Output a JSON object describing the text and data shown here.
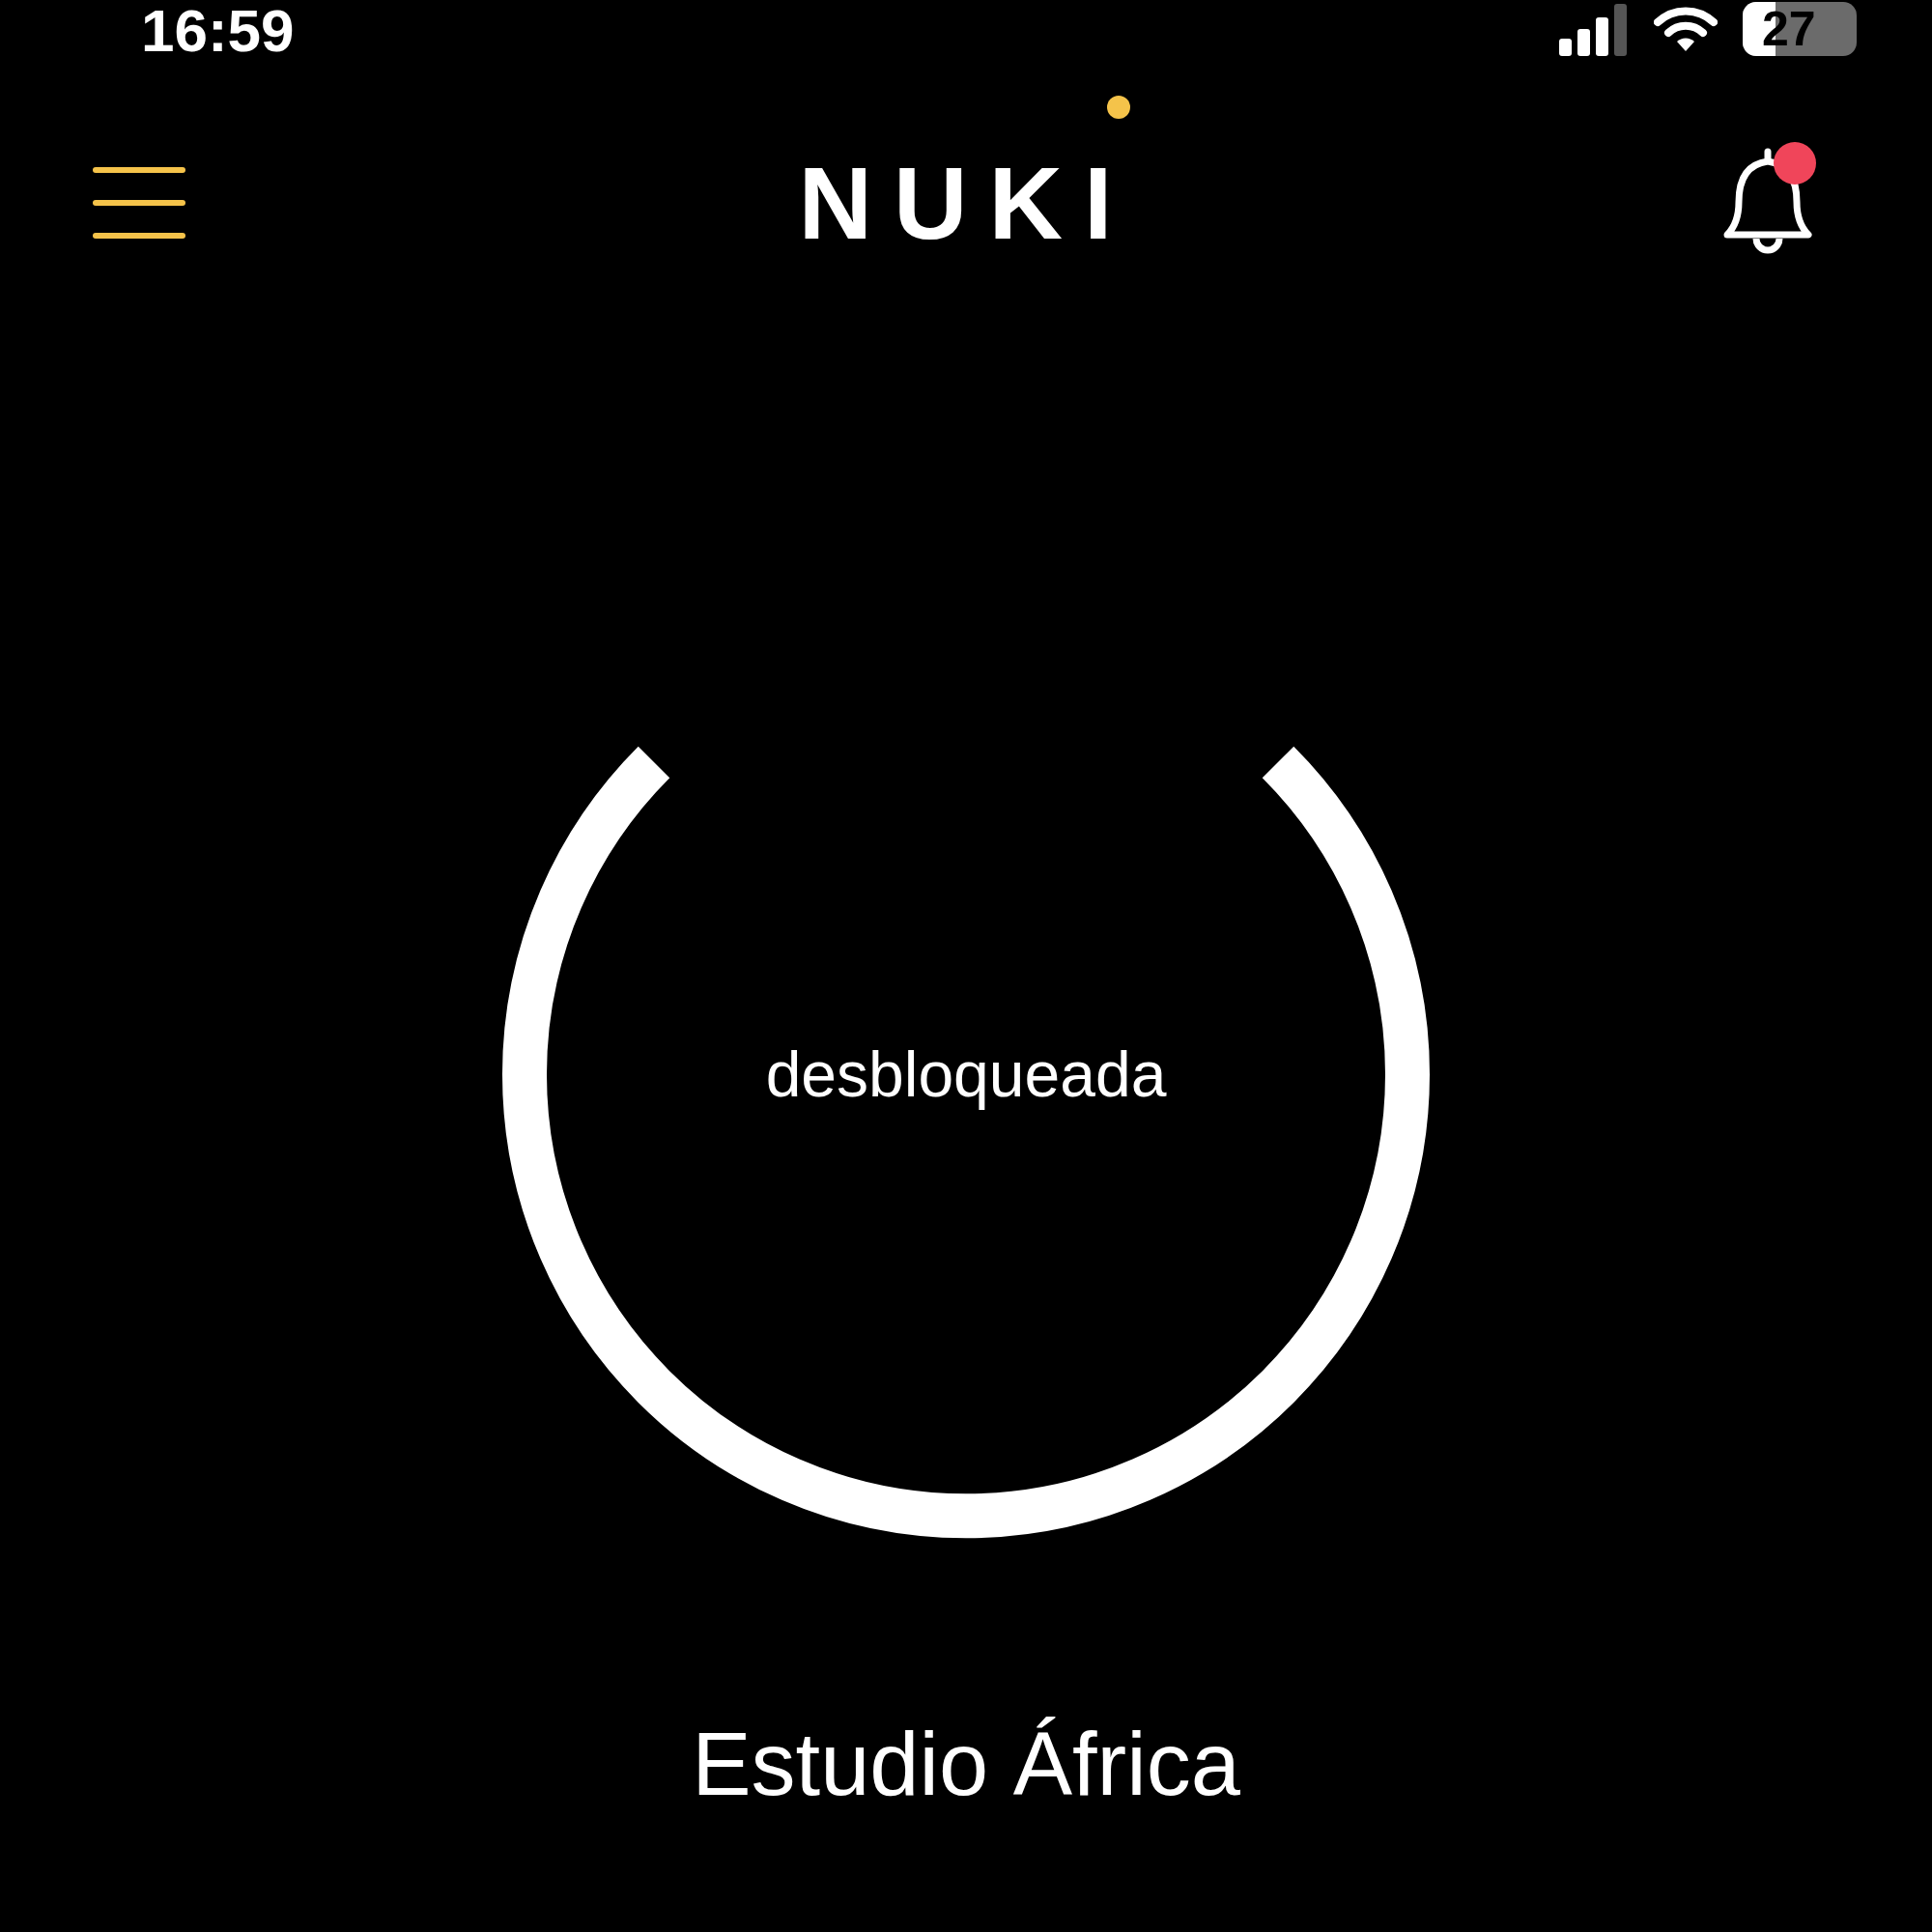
{
  "status_bar": {
    "time": "16:59",
    "battery": "27"
  },
  "header": {
    "logo": "NUKI",
    "notifications_unread": true
  },
  "lock": {
    "state_text": "desbloqueada",
    "locked": false
  },
  "device_name": "Estudio África"
}
